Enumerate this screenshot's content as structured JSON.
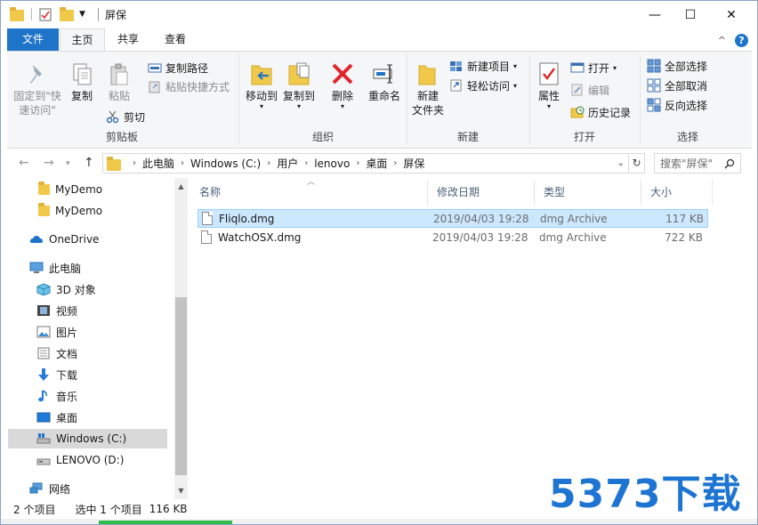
{
  "window": {
    "title": "屏保",
    "controls": {
      "minimize": "—",
      "maximize": "☐",
      "close": "✕"
    }
  },
  "ribbon_tabs": {
    "file": "文件",
    "home": "主页",
    "share": "共享",
    "view": "查看",
    "collapse": "^",
    "help": "?"
  },
  "ribbon": {
    "clipboard": {
      "label": "剪贴板",
      "pin": "固定到\"快\n速访问\"",
      "copy": "复制",
      "paste": "粘贴",
      "copy_path": "复制路径",
      "paste_shortcut": "粘贴快捷方式",
      "cut": "剪切"
    },
    "organize": {
      "label": "组织",
      "move_to": "移动到",
      "copy_to": "复制到",
      "delete": "删除",
      "rename": "重命名"
    },
    "new": {
      "label": "新建",
      "new_folder_line1": "新建",
      "new_folder_line2": "文件夹",
      "new_item": "新建项目",
      "easy_access": "轻松访问"
    },
    "open": {
      "label": "打开",
      "properties": "属性",
      "open": "打开",
      "edit": "编辑",
      "history": "历史记录"
    },
    "select": {
      "label": "选择",
      "select_all": "全部选择",
      "select_none": "全部取消",
      "invert": "反向选择"
    }
  },
  "address": {
    "crumbs": [
      "此电脑",
      "Windows (C:)",
      "用户",
      "lenovo",
      "桌面",
      "屏保"
    ],
    "search_placeholder": "搜索\"屏保\""
  },
  "nav_pane": {
    "items": [
      {
        "label": "MyDemo",
        "icon": "folder-icon"
      },
      {
        "label": "MyDemo",
        "icon": "folder-icon"
      },
      {
        "label": "OneDrive",
        "icon": "cloud-icon"
      },
      {
        "label": "此电脑",
        "icon": "computer-icon"
      },
      {
        "label": "3D 对象",
        "icon": "cube-icon"
      },
      {
        "label": "视频",
        "icon": "video-icon"
      },
      {
        "label": "图片",
        "icon": "picture-icon"
      },
      {
        "label": "文档",
        "icon": "document-icon"
      },
      {
        "label": "下载",
        "icon": "download-icon"
      },
      {
        "label": "音乐",
        "icon": "music-icon"
      },
      {
        "label": "桌面",
        "icon": "desktop-icon"
      },
      {
        "label": "Windows (C:)",
        "icon": "drive-icon"
      },
      {
        "label": "LENOVO (D:)",
        "icon": "drive-icon"
      },
      {
        "label": "网络",
        "icon": "network-icon"
      }
    ]
  },
  "file_list": {
    "columns": {
      "name": "名称",
      "date": "修改日期",
      "type": "类型",
      "size": "大小"
    },
    "rows": [
      {
        "name": "Fliqlo.dmg",
        "date": "2019/04/03 19:28",
        "type": "dmg Archive",
        "size": "117 KB"
      },
      {
        "name": "WatchOSX.dmg",
        "date": "2019/04/03 19:28",
        "type": "dmg Archive",
        "size": "722 KB"
      }
    ]
  },
  "status": {
    "count": "2 个项目",
    "selected": "选中 1 个项目",
    "size": "116 KB"
  },
  "watermark": "5373下载"
}
